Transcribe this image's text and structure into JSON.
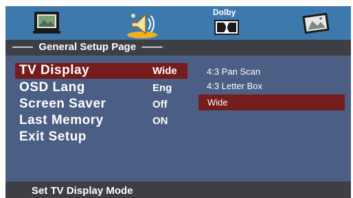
{
  "top_icons": [
    {
      "name": "tv-icon"
    },
    {
      "name": "speaker-icon"
    },
    {
      "name": "dolby-icon",
      "label": "Dolby"
    },
    {
      "name": "picture-icon"
    }
  ],
  "header": {
    "title": "——  General Setup Page  ——"
  },
  "menu": {
    "items": [
      {
        "label": "TV Display",
        "value": "Wide",
        "selected": true
      },
      {
        "label": "OSD Lang",
        "value": "Eng"
      },
      {
        "label": "Screen Saver",
        "value": "Off"
      },
      {
        "label": "Last Memory",
        "value": "ON"
      },
      {
        "label": "Exit Setup",
        "value": ""
      }
    ]
  },
  "options": {
    "items": [
      "4:3 Pan Scan",
      "4:3 Letter Box"
    ],
    "selected": "Wide"
  },
  "status": {
    "text": "Set TV Display Mode"
  },
  "colors": {
    "accent": "#751c1d",
    "topbar": "#3e79ae",
    "panel": "#4b5e83",
    "bar": "#3d3f44"
  }
}
